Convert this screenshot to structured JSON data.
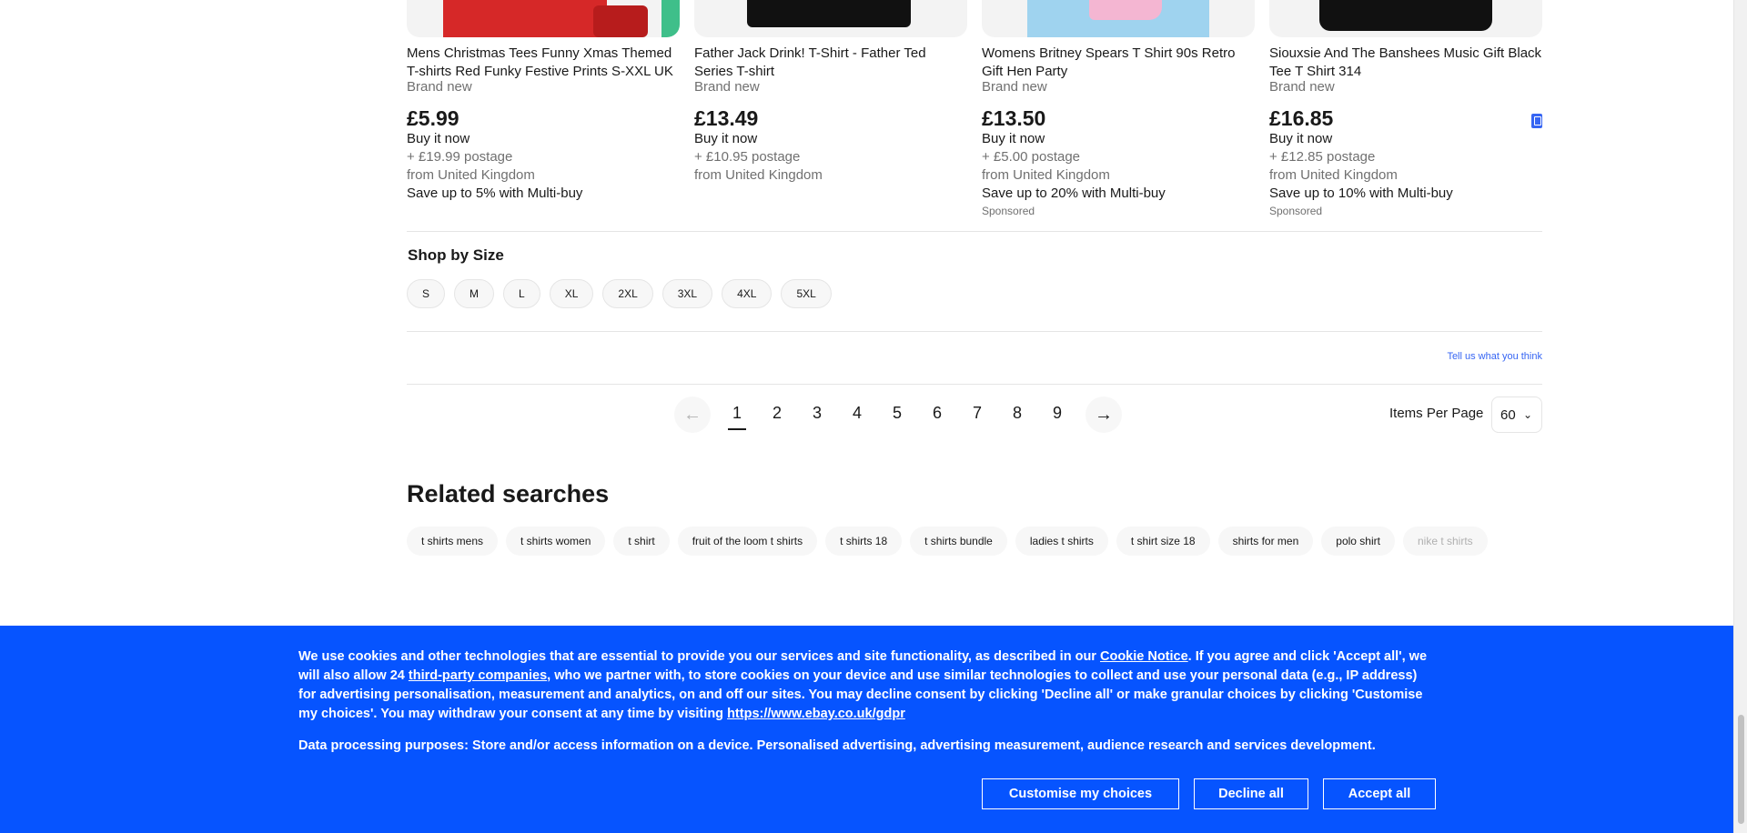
{
  "products": [
    {
      "title": "Mens Christmas Tees Funny Xmas Themed T-shirts Red Funky Festive Prints S-XXL UK",
      "condition": "Brand new",
      "price": "£5.99",
      "buy_format": "Buy it now",
      "postage": "+ £19.99 postage",
      "location": "from United Kingdom",
      "promo": "Save up to 5% with Multi-buy",
      "sponsored": "",
      "image_colors": [
        "#d62828",
        "#ffffff"
      ]
    },
    {
      "title": "Father Jack Drink! T-Shirt - Father Ted Series T-shirt",
      "condition": "Brand new",
      "price": "£13.49",
      "buy_format": "Buy it now",
      "postage": "+ £10.95 postage",
      "location": "from United Kingdom",
      "promo": "",
      "sponsored": "",
      "image_colors": [
        "#111111"
      ]
    },
    {
      "title": "Womens Britney Spears T Shirt 90s Retro Gift Hen Party",
      "condition": "Brand new",
      "price": "£13.50",
      "buy_format": "Buy it now",
      "postage": "+ £5.00 postage",
      "location": "from United Kingdom",
      "promo": "Save up to 20% with Multi-buy",
      "sponsored": "Sponsored",
      "image_colors": [
        "#9fd3ef",
        "#f4b6d2"
      ]
    },
    {
      "title": "Siouxsie And The Banshees Music Gift Black Tee T Shirt 314",
      "condition": "Brand new",
      "price": "£16.85",
      "buy_format": "Buy it now",
      "postage": "+ £12.85 postage",
      "location": "from United Kingdom",
      "promo": "Save up to 10% with Multi-buy",
      "sponsored": "Sponsored",
      "image_colors": [
        "#111111"
      ]
    }
  ],
  "shop_by_size": {
    "title": "Shop by Size",
    "sizes": [
      "S",
      "M",
      "L",
      "XL",
      "2XL",
      "3XL",
      "4XL",
      "5XL"
    ]
  },
  "feedback_link": "Tell us what you think",
  "pagination": {
    "pages": [
      "1",
      "2",
      "3",
      "4",
      "5",
      "6",
      "7",
      "8",
      "9"
    ],
    "current": "1",
    "prev_icon": "arrow-left-icon",
    "next_icon": "arrow-right-icon",
    "items_per_page_label": "Items Per Page",
    "items_per_page_value": "60"
  },
  "related": {
    "title": "Related searches",
    "items": [
      "t shirts mens",
      "t shirts women",
      "t shirt",
      "fruit of the loom t shirts",
      "t shirts 18",
      "t shirts bundle",
      "ladies t shirts",
      "t shirt size 18",
      "shirts for men",
      "polo shirt",
      "nike t shirts"
    ]
  },
  "cookie": {
    "p1": "We use cookies and other technologies that are essential to provide you our services and site functionality, as described in our ",
    "cookie_notice_link": "Cookie Notice",
    "p2": ". If you agree and click 'Accept all', we will also allow 24 ",
    "third_party_link": "third-party companies",
    "p3": ", who we partner with, to store cookies on your device and use similar technologies to collect and use your personal data (e.g., IP address) for advertising personalisation, measurement and analytics, on and off our sites. You may decline consent by clicking 'Decline all' or make granular choices by clicking 'Customise my choices'. You may withdraw your consent at any time by visiting ",
    "gdpr_link": "https://www.ebay.co.uk/gdpr",
    "purposes": "Data processing purposes: Store and/or access information on a device. Personalised advertising, advertising measurement, audience research and services development.",
    "customise": "Customise my choices",
    "decline": "Decline all",
    "accept": "Accept all",
    "background": "#0654ff"
  },
  "watch_icon": "bookmark-icon"
}
